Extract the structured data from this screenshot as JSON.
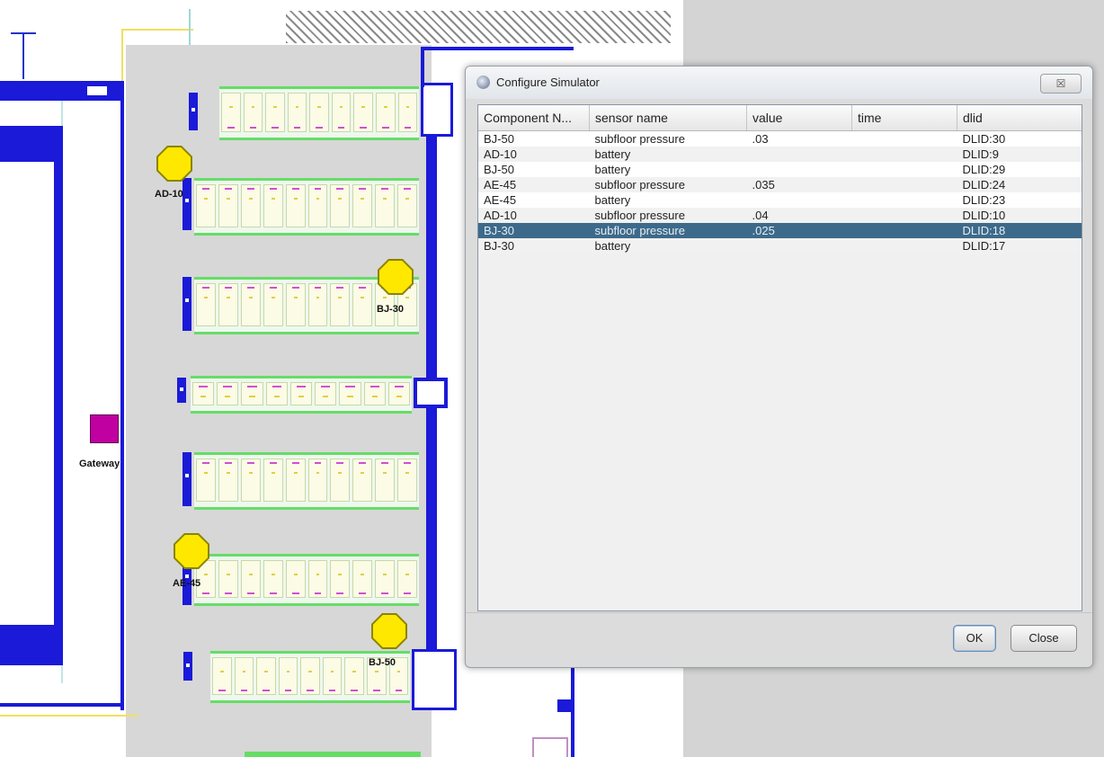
{
  "map": {
    "labels": {
      "gateway": "Gateway",
      "ad10": "AD-10",
      "bj30": "BJ-30",
      "ae45": "AE-45",
      "bj50": "BJ-50"
    },
    "colors": {
      "wall": "#1a1ad8",
      "floor": "#d7d7d7",
      "sensor": "#ffe800",
      "gateway": "#c000a0",
      "rack_border": "#66dd66"
    }
  },
  "dialog": {
    "title": "Configure Simulator",
    "close_glyph": "☒",
    "columns": [
      "Component N...",
      "sensor name",
      "value",
      "time",
      "dlid"
    ],
    "rows": [
      {
        "component": "BJ-50",
        "sensor": "subfloor pressure",
        "value": ".03",
        "time": "",
        "dlid": "DLID:30"
      },
      {
        "component": "AD-10",
        "sensor": "battery",
        "value": "",
        "time": "",
        "dlid": "DLID:9"
      },
      {
        "component": "BJ-50",
        "sensor": "battery",
        "value": "",
        "time": "",
        "dlid": "DLID:29"
      },
      {
        "component": "AE-45",
        "sensor": "subfloor pressure",
        "value": ".035",
        "time": "",
        "dlid": "DLID:24"
      },
      {
        "component": "AE-45",
        "sensor": "battery",
        "value": "",
        "time": "",
        "dlid": "DLID:23"
      },
      {
        "component": "AD-10",
        "sensor": "subfloor pressure",
        "value": ".04",
        "time": "",
        "dlid": "DLID:10"
      },
      {
        "component": "BJ-30",
        "sensor": "subfloor pressure",
        "value": ".025",
        "time": "",
        "dlid": "DLID:18"
      },
      {
        "component": "BJ-30",
        "sensor": "battery",
        "value": "",
        "time": "",
        "dlid": "DLID:17"
      }
    ],
    "selected_row": 6,
    "buttons": {
      "ok": "OK",
      "close": "Close"
    },
    "colors": {
      "selection": "#3d6a8a"
    }
  }
}
